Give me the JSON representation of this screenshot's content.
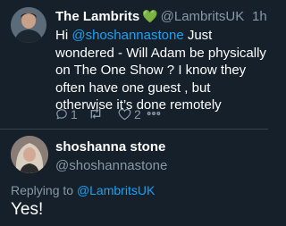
{
  "tweet": {
    "display_name": "The Lambrits",
    "verified_emoji": "💚",
    "handle": "@LambritsUK",
    "time": "1h",
    "text_before": "Hi ",
    "mention": "@shoshannastone",
    "text_after": " Just wondered - Will Adam be physically on The One Show ? I know they often have one guest , but otherwise it’s done remotely",
    "reply_count": "1",
    "retweet_count": "",
    "like_count": "2",
    "icons": [
      "reply-icon",
      "retweet-icon",
      "like-icon",
      "more-icon"
    ]
  },
  "reply": {
    "display_name": "shoshanna stone",
    "handle": "@shoshannastone",
    "replying_prefix": "Replying to ",
    "replying_handle": "@LambritsUK",
    "text": "Yes!"
  },
  "colors": {
    "background": "#15202b",
    "text": "#ffffff",
    "secondary": "#8899a6",
    "link": "#1da1f2",
    "verified_heart": "#3bb04a"
  }
}
